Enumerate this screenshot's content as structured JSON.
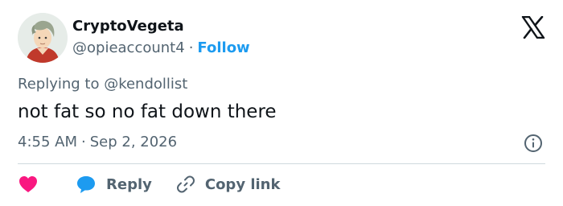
{
  "author": {
    "display_name": "CryptoVegeta",
    "handle": "@opieaccount4",
    "separator": "·",
    "follow_label": "Follow"
  },
  "brand": {
    "logo_icon": "x-logo-icon"
  },
  "reply_context": {
    "prefix": "Replying to ",
    "mention": "@kendollist"
  },
  "tweet": {
    "text": "not fat so no fat down there",
    "time": "4:55 AM",
    "separator": "·",
    "date": "Sep 2, 2026"
  },
  "actions": {
    "like_icon": "heart-icon",
    "reply_label": "Reply",
    "reply_icon": "speech-bubble-icon",
    "copy_label": "Copy link",
    "copy_icon": "link-icon",
    "info_icon": "info-icon"
  },
  "colors": {
    "accent": "#1d9bf0",
    "like": "#f91880",
    "muted": "#536471",
    "text": "#0f1419",
    "divider": "#cfd9de"
  }
}
